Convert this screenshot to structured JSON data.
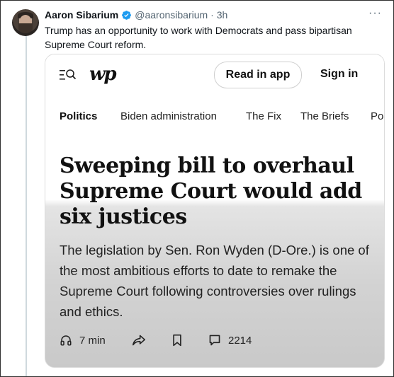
{
  "tweet": {
    "author": "Aaron Sibarium",
    "handle": "@aaronsibarium",
    "time": "· 3h",
    "more_label": "···",
    "text": "Trump has an opportunity to work with Democrats and pass bipartisan Supreme Court reform."
  },
  "card": {
    "logo": "wp",
    "read_in_app": "Read in app",
    "sign_in": "Sign in",
    "nav": [
      "Politics",
      "Biden administration",
      "The Fix",
      "The Briefs",
      "Po"
    ],
    "headline": "Sweeping bill to overhaul Supreme Court would add six justices",
    "deck": "The legislation by Sen. Ron Wyden (D-Ore.) is one of the most ambitious efforts to date to remake the Supreme Court following controversies over rulings and ethics.",
    "read_time": "7 min",
    "comment_count": "2214"
  },
  "colors": {
    "verified": "#1d9bf0",
    "handle": "#536471",
    "thread_line": "#cfd9de"
  },
  "icons": [
    "verified-badge-icon",
    "more-icon",
    "menu-search-icon",
    "headphones-icon",
    "share-icon",
    "bookmark-icon",
    "comment-icon"
  ]
}
